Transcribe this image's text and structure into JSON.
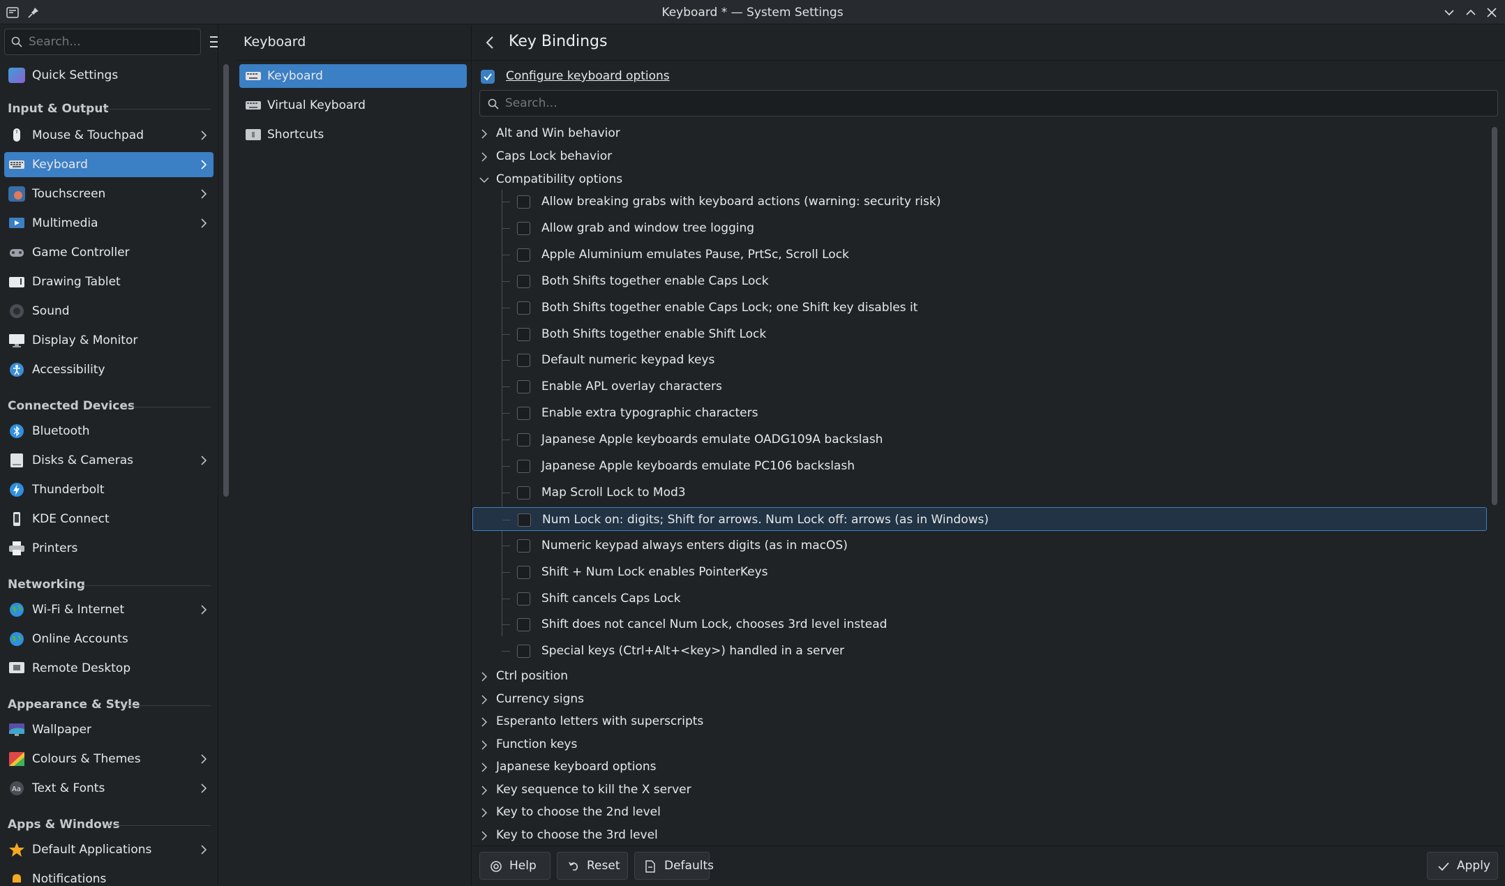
{
  "window": {
    "title": "Keyboard * — System Settings"
  },
  "sidebar": {
    "search_placeholder": "Search...",
    "quick_settings": "Quick Settings",
    "sections": {
      "input_output": "Input & Output",
      "connected_devices": "Connected Devices",
      "networking": "Networking",
      "appearance_style": "Appearance & Style",
      "apps_windows": "Apps & Windows"
    },
    "items": {
      "mouse": "Mouse & Touchpad",
      "keyboard": "Keyboard",
      "touchscreen": "Touchscreen",
      "multimedia": "Multimedia",
      "game_controller": "Game Controller",
      "drawing_tablet": "Drawing Tablet",
      "sound": "Sound",
      "display": "Display & Monitor",
      "accessibility": "Accessibility",
      "bluetooth": "Bluetooth",
      "disks": "Disks & Cameras",
      "thunderbolt": "Thunderbolt",
      "kde_connect": "KDE Connect",
      "printers": "Printers",
      "wifi": "Wi-Fi & Internet",
      "online_accounts": "Online Accounts",
      "remote_desktop": "Remote Desktop",
      "wallpaper": "Wallpaper",
      "colours": "Colours & Themes",
      "text_fonts": "Text & Fonts",
      "default_apps": "Default Applications",
      "notifications": "Notifications"
    }
  },
  "middle": {
    "title": "Keyboard",
    "items": [
      "Keyboard",
      "Virtual Keyboard",
      "Shortcuts"
    ]
  },
  "main": {
    "title": "Key Bindings",
    "configure_label": "Configure keyboard options",
    "configure_checked": true,
    "search_placeholder": "Search...",
    "groups_before": [
      "Alt and Win behavior",
      "Caps Lock behavior"
    ],
    "expanded_group": "Compatibility options",
    "options": [
      "Allow breaking grabs with keyboard actions (warning: security risk)",
      "Allow grab and window tree logging",
      "Apple Aluminium emulates Pause, PrtSc, Scroll Lock",
      "Both Shifts together enable Caps Lock",
      "Both Shifts together enable Caps Lock; one Shift key disables it",
      "Both Shifts together enable Shift Lock",
      "Default numeric keypad keys",
      "Enable APL overlay characters",
      "Enable extra typographic characters",
      "Japanese Apple keyboards emulate OADG109A backslash",
      "Japanese Apple keyboards emulate PC106 backslash",
      "Map Scroll Lock to Mod3",
      "Num Lock on: digits; Shift for arrows. Num Lock off: arrows (as in Windows)",
      "Numeric keypad always enters digits (as in macOS)",
      "Shift + Num Lock enables PointerKeys",
      "Shift cancels Caps Lock",
      "Shift does not cancel Num Lock, chooses 3rd level instead",
      "Special keys (Ctrl+Alt+<key>) handled in a server"
    ],
    "highlighted_option": "Num Lock on: digits; Shift for arrows. Num Lock off: arrows (as in Windows)",
    "groups_after": [
      "Ctrl position",
      "Currency signs",
      "Esperanto letters with superscripts",
      "Function keys",
      "Japanese keyboard options",
      "Key sequence to kill the X server",
      "Key to choose the 2nd level",
      "Key to choose the 3rd level"
    ]
  },
  "footer": {
    "help": "Help",
    "reset": "Reset",
    "defaults": "Defaults",
    "apply": "Apply"
  },
  "colors": {
    "accent": "#3b7fc4",
    "background": "#202326",
    "highlight_row": "#213344"
  }
}
